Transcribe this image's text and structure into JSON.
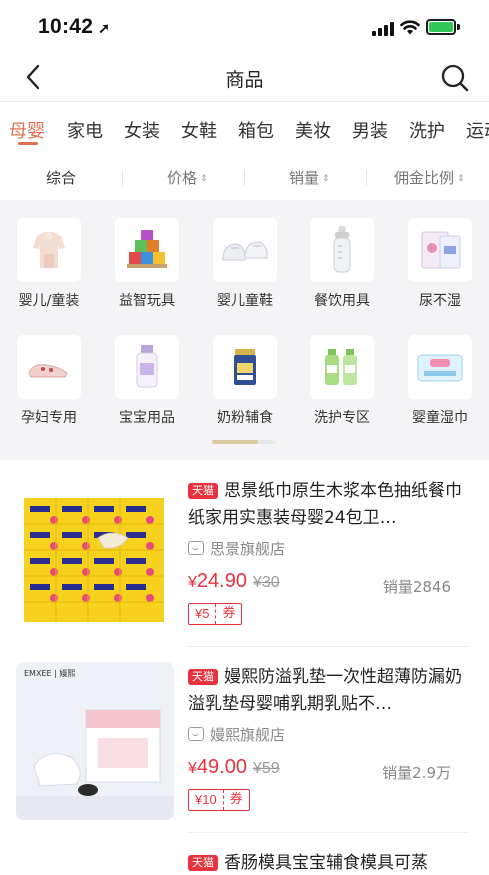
{
  "status_bar": {
    "time": "10:42",
    "location_glyph": "➚"
  },
  "nav": {
    "title": "商品",
    "back_icon": "chevron-left-icon",
    "search_icon": "search-icon"
  },
  "category_tabs": [
    {
      "label": "母婴",
      "active": true
    },
    {
      "label": "家电",
      "active": false
    },
    {
      "label": "女装",
      "active": false
    },
    {
      "label": "女鞋",
      "active": false
    },
    {
      "label": "箱包",
      "active": false
    },
    {
      "label": "美妆",
      "active": false
    },
    {
      "label": "男装",
      "active": false
    },
    {
      "label": "洗护",
      "active": false
    },
    {
      "label": "运动",
      "active": false
    }
  ],
  "sort_bar": {
    "items": [
      {
        "label": "综合",
        "arrow": ""
      },
      {
        "label": "价格",
        "arrow": "⇕"
      },
      {
        "label": "销量",
        "arrow": "⇕"
      },
      {
        "label": "佣金比例",
        "arrow": "⇕"
      }
    ]
  },
  "subcategories": [
    {
      "label": "婴儿/童装",
      "icon": "baby-clothes-icon"
    },
    {
      "label": "益智玩具",
      "icon": "toy-blocks-icon"
    },
    {
      "label": "婴儿童鞋",
      "icon": "baby-shoes-icon"
    },
    {
      "label": "餐饮用具",
      "icon": "baby-bottle-icon"
    },
    {
      "label": "尿不湿",
      "icon": "diaper-pack-icon"
    },
    {
      "label": "孕妇专用",
      "icon": "maternity-shoes-icon"
    },
    {
      "label": "宝宝用品",
      "icon": "baby-lotion-icon"
    },
    {
      "label": "奶粉辅食",
      "icon": "milk-powder-icon"
    },
    {
      "label": "洗护专区",
      "icon": "wash-bottles-icon"
    },
    {
      "label": "婴童湿巾",
      "icon": "wet-wipes-icon"
    }
  ],
  "products": [
    {
      "badge": "天猫",
      "title": "思景纸巾原生木浆本色抽纸餐巾纸家用实惠装母婴24包卫…",
      "shop": "思景旗舰店",
      "price_symbol": "¥",
      "price": "24.90",
      "original_price": "¥30",
      "sales": "销量2846",
      "coupon_amount": "¥5",
      "coupon_label": "券"
    },
    {
      "badge": "天猫",
      "title": "嫚熙防溢乳垫一次性超薄防漏奶溢乳垫母婴哺乳期乳贴不…",
      "shop": "嫚熙旗舰店",
      "price_symbol": "¥",
      "price": "49.00",
      "original_price": "¥59",
      "sales": "销量2.9万",
      "coupon_amount": "¥10",
      "coupon_label": "券",
      "image_brand": "EMXEE | 嫚熙"
    },
    {
      "badge": "天猫",
      "title": "香肠模具宝宝辅食模具可蒸"
    }
  ],
  "colors": {
    "accent": "#e36f4f",
    "price_red": "#e8333e",
    "grid_bg": "#f4f4f6",
    "battery_green": "#33c759"
  }
}
